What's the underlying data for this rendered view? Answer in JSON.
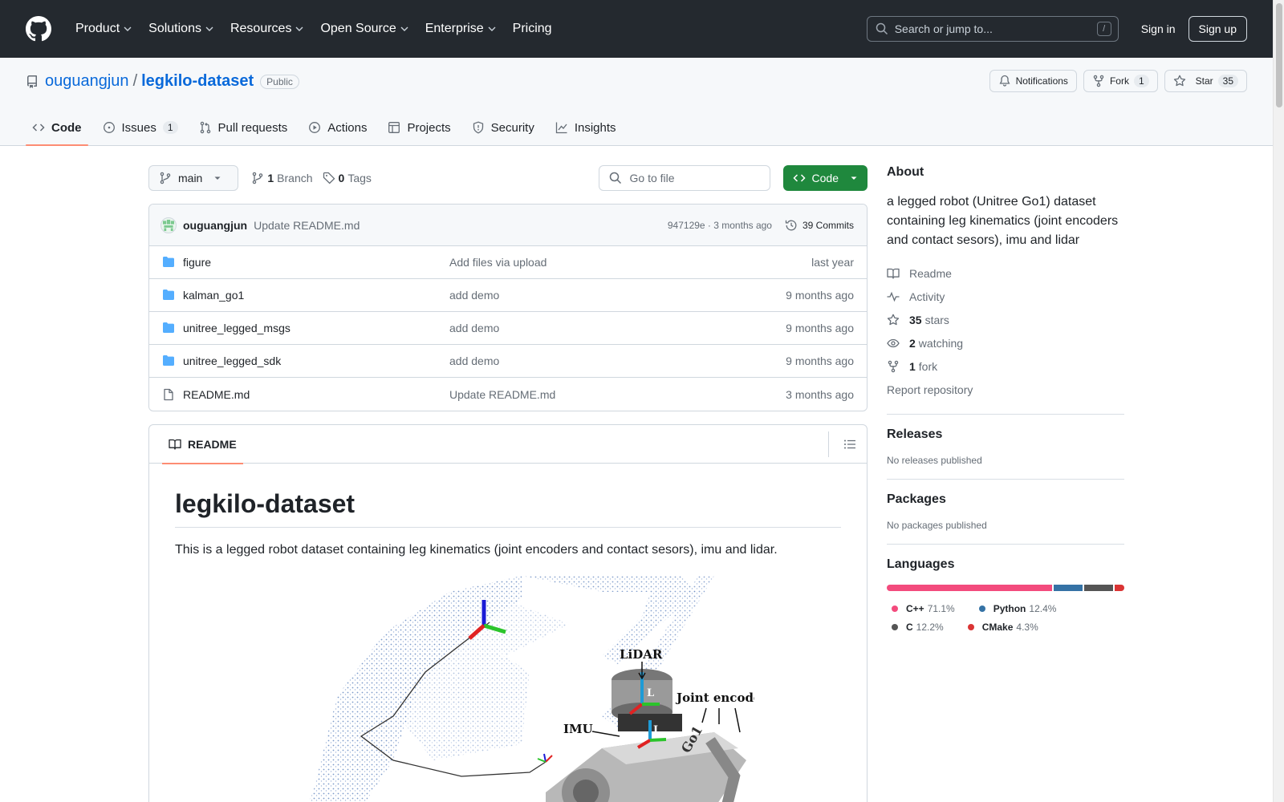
{
  "header": {
    "nav": [
      {
        "label": "Product",
        "has_menu": true
      },
      {
        "label": "Solutions",
        "has_menu": true
      },
      {
        "label": "Resources",
        "has_menu": true
      },
      {
        "label": "Open Source",
        "has_menu": true
      },
      {
        "label": "Enterprise",
        "has_menu": true
      },
      {
        "label": "Pricing",
        "has_menu": false
      }
    ],
    "search_placeholder": "Search or jump to...",
    "search_shortcut": "/",
    "sign_in": "Sign in",
    "sign_up": "Sign up"
  },
  "repo": {
    "owner": "ouguangjun",
    "separator": "/",
    "name": "legkilo-dataset",
    "visibility": "Public",
    "notifications_label": "Notifications",
    "fork_label": "Fork",
    "fork_count": "1",
    "star_label": "Star",
    "star_count": "35"
  },
  "tabs": [
    {
      "label": "Code",
      "icon": "code-icon",
      "count": null,
      "active": true
    },
    {
      "label": "Issues",
      "icon": "issue-icon",
      "count": "1",
      "active": false
    },
    {
      "label": "Pull requests",
      "icon": "pull-request-icon",
      "count": null,
      "active": false
    },
    {
      "label": "Actions",
      "icon": "play-icon",
      "count": null,
      "active": false
    },
    {
      "label": "Projects",
      "icon": "table-icon",
      "count": null,
      "active": false
    },
    {
      "label": "Security",
      "icon": "shield-icon",
      "count": null,
      "active": false
    },
    {
      "label": "Insights",
      "icon": "graph-icon",
      "count": null,
      "active": false
    }
  ],
  "toolbar": {
    "branch": "main",
    "branch_count": "1",
    "branch_label": "Branch",
    "tag_count": "0",
    "tag_label": "Tags",
    "goto_placeholder": "Go to file",
    "code_button": "Code"
  },
  "latest_commit": {
    "author": "ouguangjun",
    "message": "Update README.md",
    "hash_time": "947129e · 3 months ago",
    "commits_label": "39 Commits"
  },
  "files": [
    {
      "type": "folder",
      "name": "figure",
      "message": "Add files via upload",
      "age": "last year"
    },
    {
      "type": "folder",
      "name": "kalman_go1",
      "message": "add demo",
      "age": "9 months ago"
    },
    {
      "type": "folder",
      "name": "unitree_legged_msgs",
      "message": "add demo",
      "age": "9 months ago"
    },
    {
      "type": "folder",
      "name": "unitree_legged_sdk",
      "message": "add demo",
      "age": "9 months ago"
    },
    {
      "type": "file",
      "name": "README.md",
      "message": "Update README.md",
      "age": "3 months ago"
    }
  ],
  "readme": {
    "tab_label": "README",
    "title": "legkilo-dataset",
    "paragraph": "This is a legged robot dataset containing leg kinematics (joint encoders and contact sesors), imu and lidar.",
    "figure_labels": {
      "lidar": "LiDAR",
      "joint": "Joint encoder",
      "imu": "IMU",
      "l": "L",
      "i": "I",
      "robot": "Go1"
    }
  },
  "sidebar": {
    "about_title": "About",
    "about_text": "a legged robot (Unitree Go1) dataset containing leg kinematics (joint encoders and contact sesors), imu and lidar",
    "readme_link": "Readme",
    "activity_link": "Activity",
    "stars_count": "35",
    "stars_label": "stars",
    "watching_count": "2",
    "watching_label": "watching",
    "fork_count": "1",
    "fork_label": "fork",
    "report": "Report repository",
    "releases_title": "Releases",
    "releases_text": "No releases published",
    "packages_title": "Packages",
    "packages_text": "No packages published",
    "languages_title": "Languages",
    "languages": [
      {
        "name": "C++",
        "percent": "71.1%",
        "value": 71.1,
        "color": "#f34b7d"
      },
      {
        "name": "Python",
        "percent": "12.4%",
        "value": 12.4,
        "color": "#3572A5"
      },
      {
        "name": "C",
        "percent": "12.2%",
        "value": 12.2,
        "color": "#555555"
      },
      {
        "name": "CMake",
        "percent": "4.3%",
        "value": 4.3,
        "color": "#DA3434"
      }
    ]
  },
  "colors": {
    "header_bg": "#24292f",
    "link": "#0969da",
    "code_button": "#1f883d",
    "tab_underline": "#fd8c73",
    "folder_icon": "#54aeff"
  }
}
